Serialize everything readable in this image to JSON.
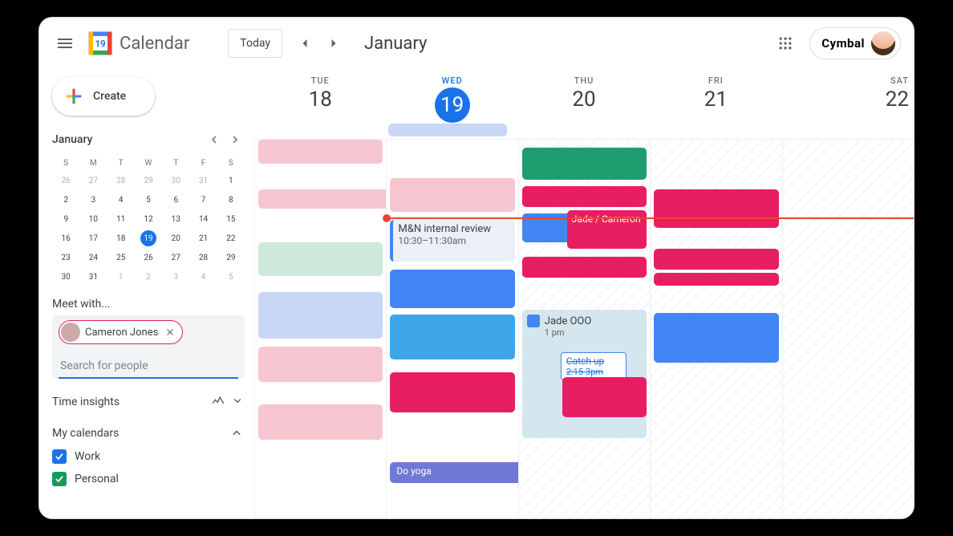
{
  "header": {
    "app_title": "Calendar",
    "today_label": "Today",
    "view_title": "January",
    "org_name": "Cymbal",
    "logo_day": "19"
  },
  "sidebar": {
    "create_label": "Create",
    "mini_month": "January",
    "weekday_heads": [
      "S",
      "M",
      "T",
      "W",
      "T",
      "F",
      "S"
    ],
    "weeks": [
      [
        {
          "d": "26",
          "dim": true
        },
        {
          "d": "27",
          "dim": true
        },
        {
          "d": "28",
          "dim": true
        },
        {
          "d": "29",
          "dim": true
        },
        {
          "d": "30",
          "dim": true
        },
        {
          "d": "31",
          "dim": true
        },
        {
          "d": "1"
        }
      ],
      [
        {
          "d": "2"
        },
        {
          "d": "3"
        },
        {
          "d": "4"
        },
        {
          "d": "5"
        },
        {
          "d": "6"
        },
        {
          "d": "7"
        },
        {
          "d": "8"
        }
      ],
      [
        {
          "d": "9"
        },
        {
          "d": "10"
        },
        {
          "d": "11"
        },
        {
          "d": "12"
        },
        {
          "d": "13"
        },
        {
          "d": "14"
        },
        {
          "d": "15"
        }
      ],
      [
        {
          "d": "16"
        },
        {
          "d": "17"
        },
        {
          "d": "18"
        },
        {
          "d": "19",
          "today": true
        },
        {
          "d": "20"
        },
        {
          "d": "21"
        },
        {
          "d": "22"
        }
      ],
      [
        {
          "d": "23"
        },
        {
          "d": "24"
        },
        {
          "d": "25"
        },
        {
          "d": "26"
        },
        {
          "d": "27"
        },
        {
          "d": "28"
        },
        {
          "d": "29"
        }
      ],
      [
        {
          "d": "30"
        },
        {
          "d": "31"
        },
        {
          "d": "1",
          "dim": true
        },
        {
          "d": "2",
          "dim": true
        },
        {
          "d": "3",
          "dim": true
        },
        {
          "d": "4",
          "dim": true
        },
        {
          "d": "5",
          "dim": true
        }
      ]
    ],
    "meet_with_label": "Meet with...",
    "chip_name": "Cameron Jones",
    "search_placeholder": "Search for people",
    "time_insights_label": "Time insights",
    "my_calendars_label": "My calendars",
    "calendars": [
      {
        "name": "Work",
        "color": "blue"
      },
      {
        "name": "Personal",
        "color": "green"
      }
    ]
  },
  "days": [
    {
      "dow": "TUE",
      "num": "18"
    },
    {
      "dow": "WED",
      "num": "19",
      "today": true
    },
    {
      "dow": "THU",
      "num": "20"
    },
    {
      "dow": "FRI",
      "num": "21"
    },
    {
      "dow": "SAT",
      "num": "22"
    }
  ],
  "events": {
    "review_title": "M&N internal review",
    "review_time": "10:30–11:30am",
    "jade_cameron": "Jade / Cameron",
    "jade_ooo": "Jade OOO",
    "jade_ooo_time": "1 pm",
    "catchup": "Catch up",
    "catchup_time": "2:15-3pm",
    "yoga": "Do yoga"
  },
  "colors": {
    "blue": "#4285f4",
    "deep_blue": "#1a73e8",
    "pink": "#f6c6d0",
    "magenta": "#e81e63",
    "lavender": "#c7d7f5",
    "green": "#0f9d58",
    "teal": "#1e8e6e",
    "mint": "#cfe8dc",
    "lilac": "#7079d4",
    "cyan": "#3ea6e8",
    "ooo_bg": "#d4e6ee",
    "grey_text": "#5f6368"
  }
}
